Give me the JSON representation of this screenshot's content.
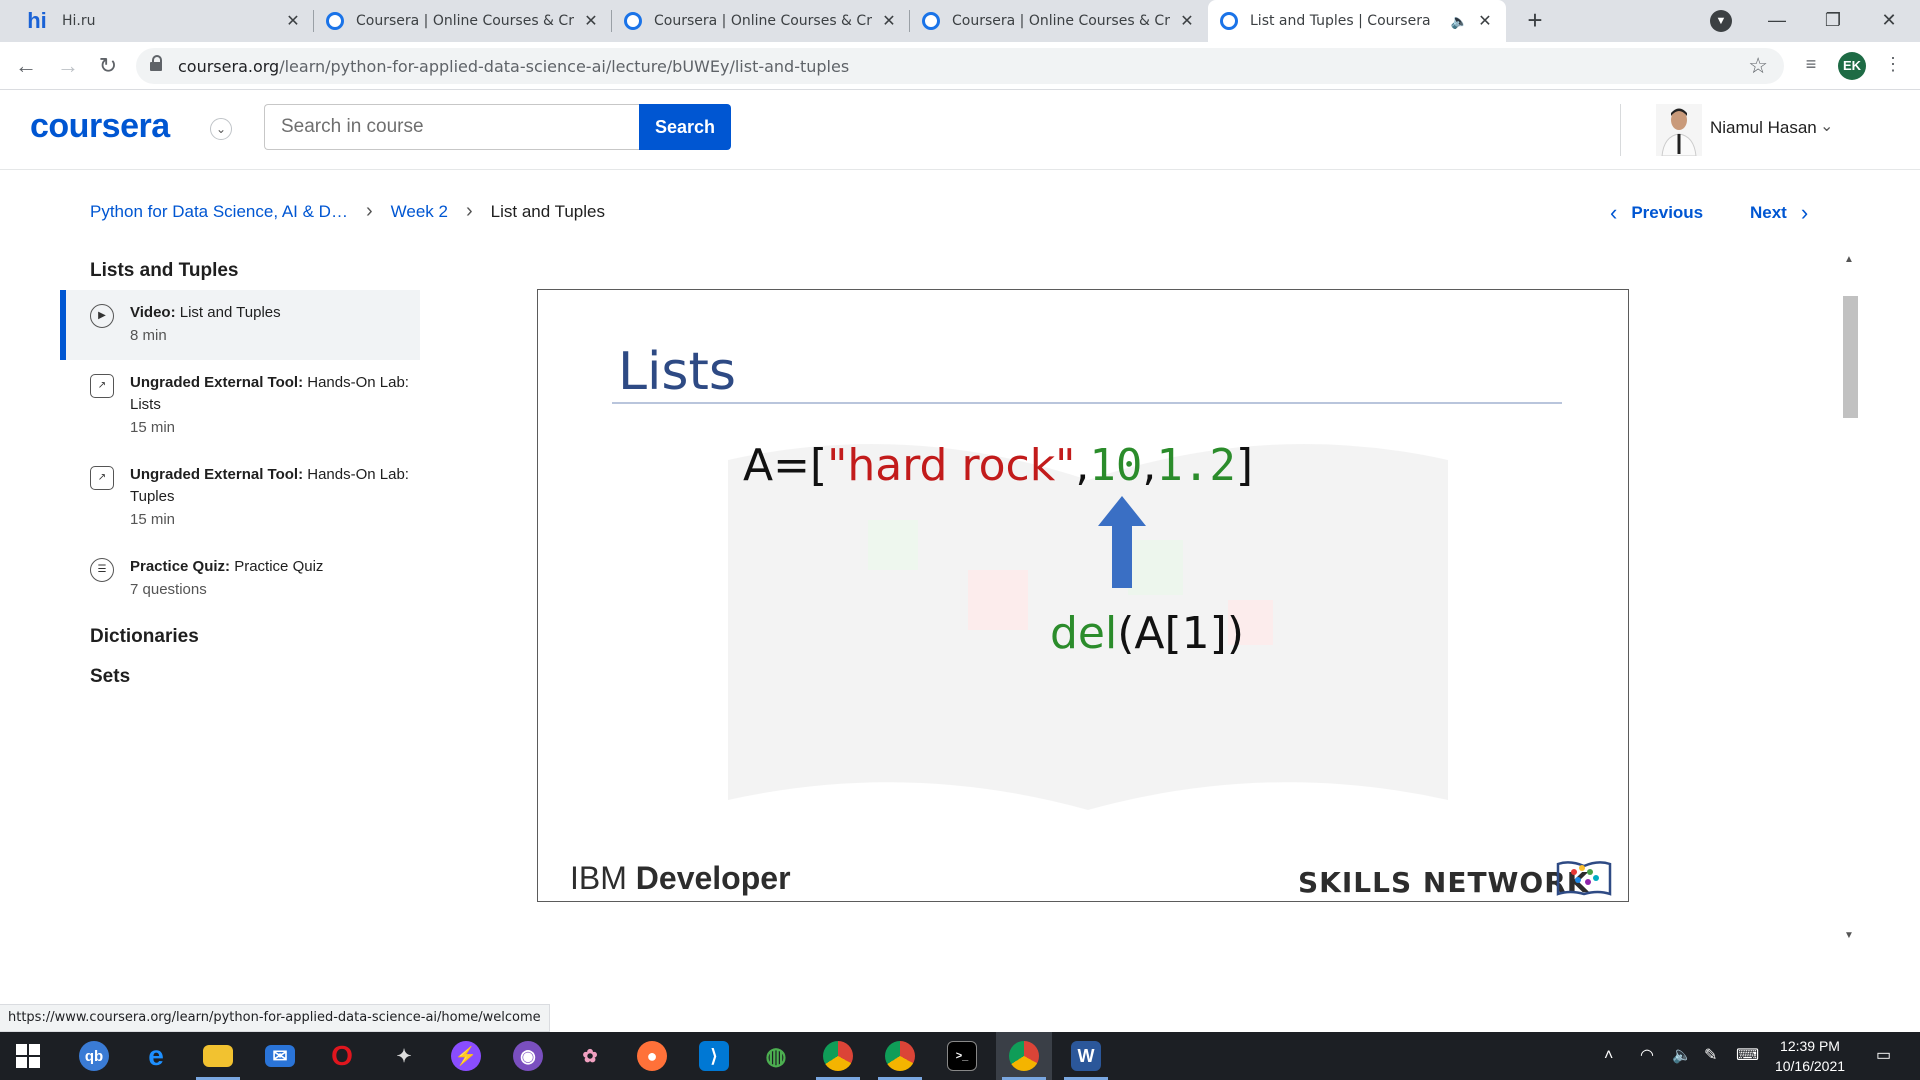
{
  "browser": {
    "tabs": [
      {
        "title": "Hi.ru",
        "favicon": "hi-icon",
        "active": false
      },
      {
        "title": "Coursera | Online Courses & Credentials",
        "favicon": "coursera-icon",
        "active": false
      },
      {
        "title": "Coursera | Online Courses & Credentials",
        "favicon": "coursera-icon",
        "active": false
      },
      {
        "title": "Coursera | Online Courses & Credentials",
        "favicon": "coursera-icon",
        "active": false
      },
      {
        "title": "List and Tuples | Coursera",
        "favicon": "coursera-icon",
        "active": true
      }
    ],
    "url_domain": "coursera.org",
    "url_path": "/learn/python-for-applied-data-science-ai/lecture/bUWEy/list-and-tuples",
    "profile_initials": "EK"
  },
  "header": {
    "logo": "coursera",
    "search_placeholder": "Search in course",
    "search_button": "Search",
    "user_name": "Niamul Hasan"
  },
  "breadcrumb": {
    "course": "Python for Data Science, AI & D…",
    "week": "Week 2",
    "current": "List and Tuples"
  },
  "nav": {
    "previous": "Previous",
    "next": "Next"
  },
  "sidebar": {
    "section_title": "Lists and Tuples",
    "items": [
      {
        "type": "Video:",
        "title": "List and Tuples",
        "meta": "8 min",
        "icon": "play-icon",
        "active": true
      },
      {
        "type": "Ungraded External Tool:",
        "title": "Hands-On Lab: Lists",
        "meta": "15 min",
        "icon": "external-tool-icon",
        "active": false
      },
      {
        "type": "Ungraded External Tool:",
        "title": "Hands-On Lab: Tuples",
        "meta": "15 min",
        "icon": "external-tool-icon",
        "active": false
      },
      {
        "type": "Practice Quiz:",
        "title": "Practice Quiz",
        "meta": "7 questions",
        "icon": "quiz-icon",
        "active": false
      }
    ],
    "other_sections": [
      "Dictionaries",
      "Sets"
    ]
  },
  "video": {
    "slide_title": "Lists",
    "code_prefix": "A=[",
    "code_string": "\"hard rock\"",
    "code_comma1": ",",
    "code_num1": "10",
    "code_comma2": ",",
    "code_num2": "1.2",
    "code_suffix": "]",
    "del_fn": "del",
    "del_args": "(A[1])",
    "brand_left_light": "IBM",
    "brand_left_bold": "Developer",
    "brand_right": "SKILLS NETWORK",
    "colors": {
      "title": "#2e4a84",
      "string": "#c21b1b",
      "number": "#2b8c2b",
      "arrow": "#3a6fc4"
    }
  },
  "statusbar": {
    "link": "https://www.coursera.org/learn/python-for-applied-data-science-ai/home/welcome"
  },
  "taskbar": {
    "time": "12:39 PM",
    "date": "10/16/2021"
  },
  "colors": {
    "brand": "#0056d2"
  }
}
